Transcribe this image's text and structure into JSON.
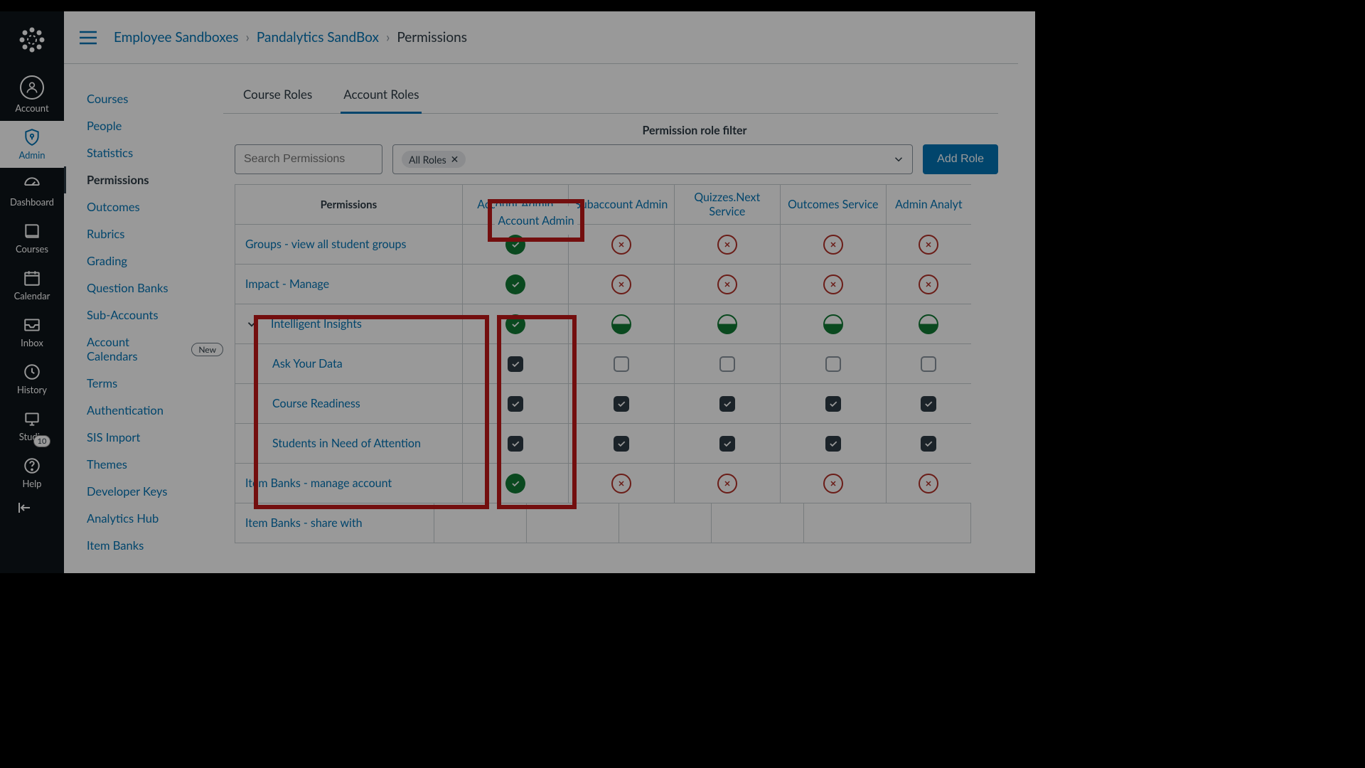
{
  "gnav": {
    "items": [
      {
        "label": "Account"
      },
      {
        "label": "Admin"
      },
      {
        "label": "Dashboard"
      },
      {
        "label": "Courses"
      },
      {
        "label": "Calendar"
      },
      {
        "label": "Inbox"
      },
      {
        "label": "History"
      },
      {
        "label": "Studio"
      },
      {
        "label": "Help",
        "badge": "10"
      }
    ]
  },
  "snav": {
    "items": [
      {
        "label": "Courses"
      },
      {
        "label": "People"
      },
      {
        "label": "Statistics"
      },
      {
        "label": "Permissions",
        "active": true
      },
      {
        "label": "Outcomes"
      },
      {
        "label": "Rubrics"
      },
      {
        "label": "Grading"
      },
      {
        "label": "Question Banks"
      },
      {
        "label": "Sub-Accounts"
      },
      {
        "label": "Account Calendars",
        "pill": "New"
      },
      {
        "label": "Terms"
      },
      {
        "label": "Authentication"
      },
      {
        "label": "SIS Import"
      },
      {
        "label": "Themes"
      },
      {
        "label": "Developer Keys"
      },
      {
        "label": "Analytics Hub"
      },
      {
        "label": "Item Banks"
      }
    ]
  },
  "breadcrumbs": {
    "a": "Employee Sandboxes",
    "b": "Pandalytics SandBox",
    "c": "Permissions"
  },
  "tabs": {
    "a": "Course Roles",
    "b": "Account Roles"
  },
  "filter": {
    "label": "Permission role filter",
    "search_placeholder": "Search Permissions",
    "chip": "All Roles",
    "add": "Add Role"
  },
  "roles": [
    "Account Admin",
    "Subaccount Admin",
    "Quizzes.Next Service",
    "Outcomes Service",
    "Admin Analyt"
  ],
  "perm_header": "Permissions",
  "rows": [
    {
      "label": "Groups - view all student groups",
      "cells": [
        "enabled",
        "disabled",
        "disabled",
        "disabled",
        "disabled"
      ]
    },
    {
      "label": "Impact - Manage",
      "cells": [
        "enabled",
        "disabled",
        "disabled",
        "disabled",
        "disabled"
      ]
    },
    {
      "label": "Intelligent Insights",
      "expand": true,
      "cells": [
        "enabled",
        "partial",
        "partial",
        "partial",
        "partial"
      ]
    },
    {
      "label": "Ask Your Data",
      "indent": true,
      "cells": [
        "checked",
        "unchecked",
        "unchecked",
        "unchecked",
        "unchecked"
      ]
    },
    {
      "label": "Course Readiness",
      "indent": true,
      "cells": [
        "checked",
        "checked",
        "checked",
        "checked",
        "checked"
      ]
    },
    {
      "label": "Students in Need of Attention",
      "indent": true,
      "cells": [
        "checked",
        "checked",
        "checked",
        "checked",
        "checked"
      ]
    },
    {
      "label": "Item Banks - manage account",
      "cells": [
        "enabled",
        "disabled",
        "disabled",
        "disabled",
        "disabled"
      ]
    },
    {
      "label": "Item Banks - share with",
      "cells": [
        "",
        "",
        "",
        "",
        "",
        ""
      ]
    }
  ],
  "highlight_header": "Account Admin"
}
